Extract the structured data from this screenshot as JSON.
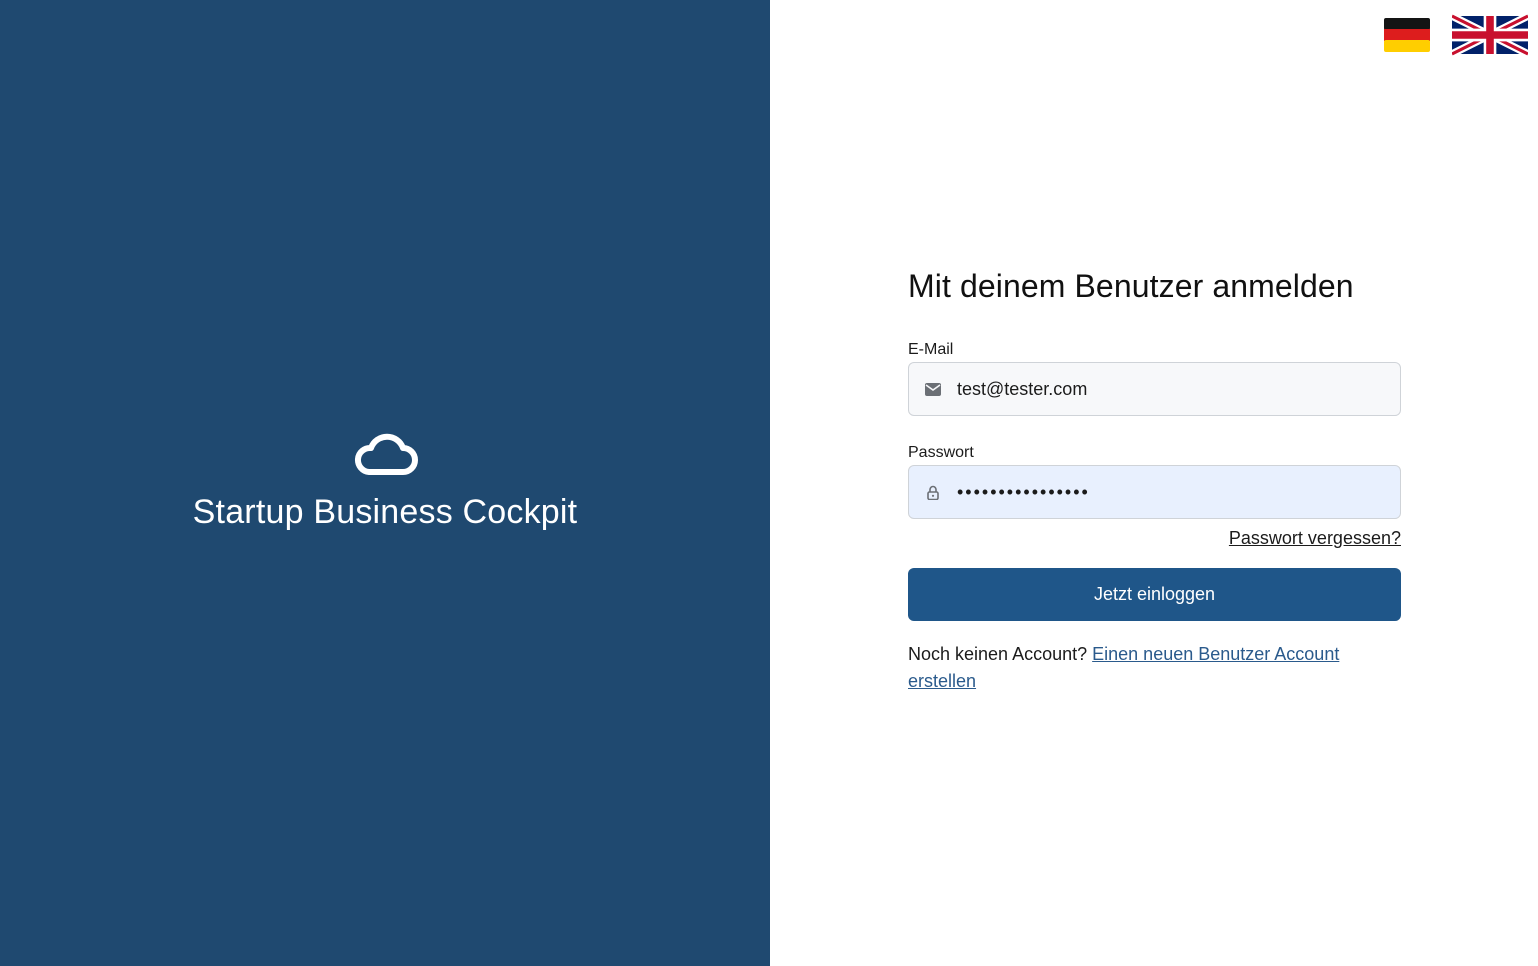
{
  "brand": {
    "name": "Startup Business Cockpit",
    "icon": "cloud-icon",
    "panel_color": "#1f4970"
  },
  "languages": [
    {
      "code": "de",
      "icon": "flag-germany-icon"
    },
    {
      "code": "en",
      "icon": "flag-uk-icon"
    }
  ],
  "form": {
    "title": "Mit deinem Benutzer anmelden",
    "email": {
      "label": "E-Mail",
      "value": "test@tester.com",
      "icon": "mail-icon"
    },
    "password": {
      "label": "Passwort",
      "value": "••••••••••••••••",
      "icon": "lock-icon"
    },
    "forgot_label": "Passwort vergessen?",
    "submit_label": "Jetzt einloggen",
    "submit_color": "#1f5689",
    "register_prompt": "Noch keinen Account?",
    "register_link": "Einen neuen Benutzer Account erstellen"
  }
}
